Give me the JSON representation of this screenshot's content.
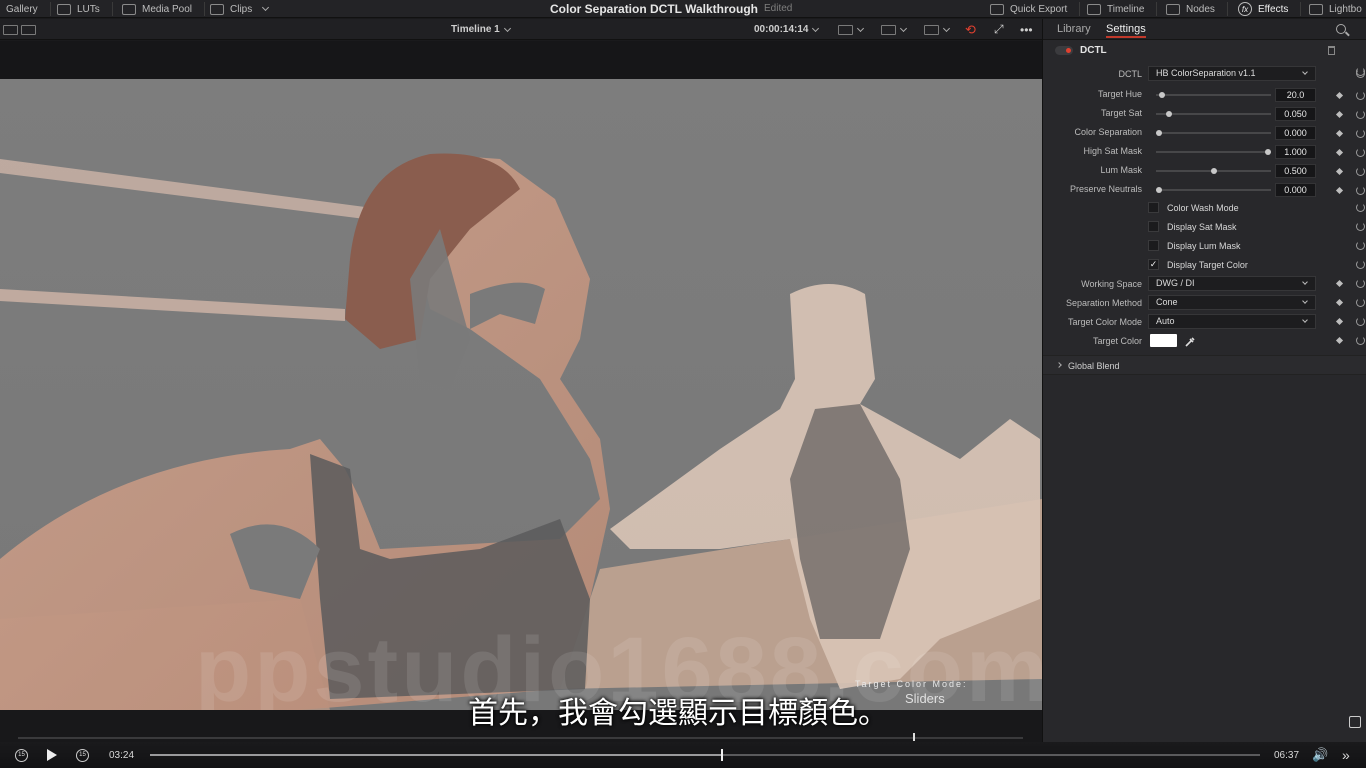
{
  "app": {
    "title": "Color Separation DCTL Walkthrough",
    "status": "Edited"
  },
  "topbar": {
    "left": [
      {
        "label": "Gallery",
        "icon": "gallery-icon"
      },
      {
        "label": "LUTs",
        "icon": "luts-icon"
      },
      {
        "label": "Media Pool",
        "icon": "media-pool-icon"
      },
      {
        "label": "Clips",
        "icon": "clips-icon"
      }
    ],
    "right": [
      {
        "label": "Quick Export",
        "icon": "upload-icon"
      },
      {
        "label": "Timeline",
        "icon": "timeline-icon"
      },
      {
        "label": "Nodes",
        "icon": "nodes-icon"
      },
      {
        "label": "Effects",
        "icon": "fx-icon"
      },
      {
        "label": "Lightbo",
        "icon": "lightbox-icon"
      }
    ]
  },
  "viewer": {
    "timeline_name": "Timeline 1",
    "timecode": "00:00:14:14",
    "overlay_label": "Target  Color  Mode:",
    "overlay_value": "Sliders",
    "watermark": "ppstudio1688.com",
    "subtitle": "首先，我會勾選顯示目標顏色。"
  },
  "panel": {
    "tabs": [
      {
        "label": "Library",
        "active": false
      },
      {
        "label": "Settings",
        "active": true
      }
    ],
    "effect_name": "DCTL",
    "dctl_label": "DCTL",
    "dctl_value": "HB ColorSeparation v1.1",
    "sliders": [
      {
        "label": "Target Hue",
        "value": "20.0",
        "pos": 0.03
      },
      {
        "label": "Target Sat",
        "value": "0.050",
        "pos": 0.09
      },
      {
        "label": "Color Separation",
        "value": "0.000",
        "pos": 0.0
      },
      {
        "label": "High Sat Mask",
        "value": "1.000",
        "pos": 1.0
      },
      {
        "label": "Lum Mask",
        "value": "0.500",
        "pos": 0.5
      },
      {
        "label": "Preserve Neutrals",
        "value": "0.000",
        "pos": 0.0
      }
    ],
    "checkboxes": [
      {
        "label": "Color Wash Mode",
        "checked": false
      },
      {
        "label": "Display Sat Mask",
        "checked": false
      },
      {
        "label": "Display Lum Mask",
        "checked": false
      },
      {
        "label": "Display Target Color",
        "checked": true
      }
    ],
    "dropdowns": [
      {
        "label": "Working Space",
        "value": "DWG / DI"
      },
      {
        "label": "Separation Method",
        "value": "Cone"
      },
      {
        "label": "Target Color Mode",
        "value": "Auto"
      }
    ],
    "target_color_label": "Target Color",
    "target_color_hex": "#ffffff",
    "global_blend": "Global Blend",
    "accent_color": "#c0392b"
  },
  "player": {
    "current_time": "03:24",
    "total_time": "06:37",
    "progress": 0.514
  }
}
